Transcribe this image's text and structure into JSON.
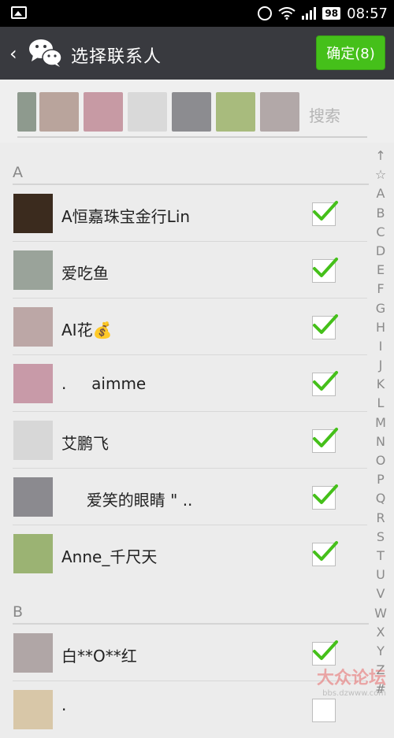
{
  "status": {
    "battery": "98",
    "time": "08:57"
  },
  "header": {
    "title": "选择联系人",
    "confirm_label": "确定(8)"
  },
  "search": {
    "placeholder": "搜索"
  },
  "selected_avatars": [
    "#8e9a8e",
    "#b9a49c",
    "#c79aa4",
    "#d9d9d9",
    "#8c8c90",
    "#a8bb7d",
    "#b2a8a8"
  ],
  "sections": [
    {
      "label": "A",
      "contacts": [
        {
          "name": "A恒嘉珠宝金行Lin",
          "checked": true,
          "avatar_color": "#3b2b1e"
        },
        {
          "name": "爱吃鱼",
          "checked": true,
          "avatar_color": "#9aa39a"
        },
        {
          "name": "AI花💰",
          "checked": true,
          "avatar_color": "#bca7a6"
        },
        {
          "name": ".     aimme",
          "checked": true,
          "avatar_color": "#c89aa8"
        },
        {
          "name": "艾鹏飞",
          "checked": true,
          "avatar_color": "#d7d7d7"
        },
        {
          "name": "     爱笑的眼睛 \" ..",
          "checked": true,
          "avatar_color": "#8b8a8f"
        },
        {
          "name": "Anne_千尺天",
          "checked": true,
          "avatar_color": "#9bb373"
        }
      ]
    },
    {
      "label": "B",
      "contacts": [
        {
          "name": "白**O**红",
          "checked": true,
          "avatar_color": "#b0a6a6"
        },
        {
          "name": "·",
          "checked": false,
          "avatar_color": "#d8c7a8"
        }
      ]
    }
  ],
  "index_letters": [
    "↑",
    "☆",
    "A",
    "B",
    "C",
    "D",
    "E",
    "F",
    "G",
    "H",
    "I",
    "J",
    "K",
    "L",
    "M",
    "N",
    "O",
    "P",
    "Q",
    "R",
    "S",
    "T",
    "U",
    "V",
    "W",
    "X",
    "Y",
    "Z",
    "#"
  ],
  "watermark": {
    "text": "大众论坛",
    "url": "bbs.dzwww.com"
  }
}
